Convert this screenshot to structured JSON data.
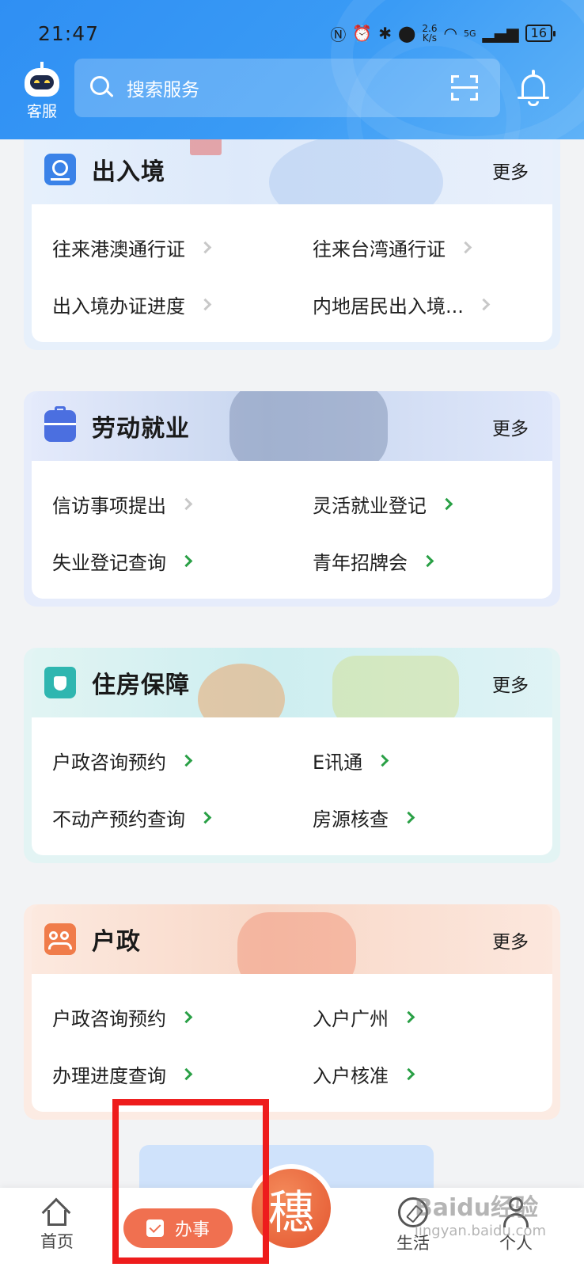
{
  "status_bar": {
    "time": "21:47",
    "net_speed_top": "2.6",
    "net_speed_bottom": "K/s",
    "signal_label": "5G",
    "battery": "16"
  },
  "header": {
    "assistant_label": "客服",
    "search_placeholder": "搜索服务"
  },
  "sections": [
    {
      "title": "出入境",
      "more": "更多",
      "items": [
        "往来港澳通行证",
        "往来台湾通行证",
        "出入境办证进度",
        "内地居民出入境..."
      ]
    },
    {
      "title": "劳动就业",
      "more": "更多",
      "items": [
        "信访事项提出",
        "灵活就业登记",
        "失业登记查询",
        "青年招牌会"
      ]
    },
    {
      "title": "住房保障",
      "more": "更多",
      "items": [
        "户政咨询预约",
        "E讯通",
        "不动产预约查询",
        "房源核查"
      ]
    },
    {
      "title": "户政",
      "more": "更多",
      "items": [
        "户政咨询预约",
        "入户广州",
        "办理进度查询",
        "入户核准"
      ]
    }
  ],
  "bottom_nav": {
    "home": "首页",
    "banshi": "办事",
    "center_glyph": "穗",
    "life": "生活",
    "me": "个人"
  },
  "watermark": {
    "main": "Baidu经验",
    "sub": "jingyan.baidu.com"
  },
  "colors": {
    "header_blue": "#2f8ff3",
    "accent_orange": "#f07050",
    "chevron_green": "#2aa046",
    "highlight_red": "#ee1c1c"
  }
}
